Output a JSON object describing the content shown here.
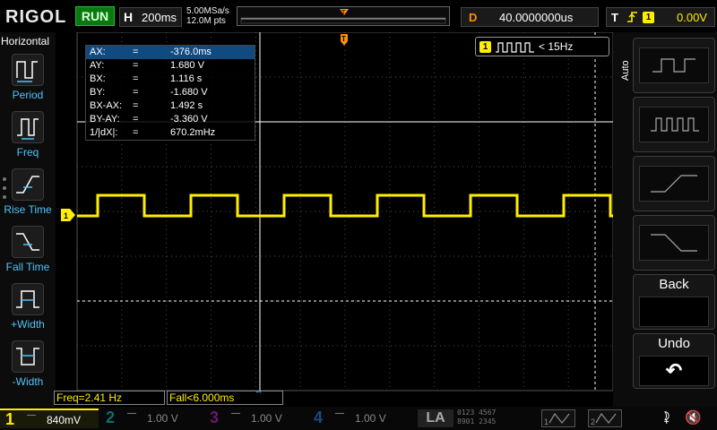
{
  "topbar": {
    "logo": "RIGOL",
    "run_status": "RUN",
    "horizontal_label": "H",
    "timebase": "200ms",
    "sample_rate": "5.00MSa/s",
    "memory_depth": "12.0M pts",
    "delay_label": "D",
    "delay_value": "40.0000000us",
    "trigger_label": "T",
    "trigger_edge": "ℱ",
    "trigger_source": "1",
    "trigger_level": "0.00V"
  },
  "left_menu": {
    "title": "Horizontal",
    "items": [
      {
        "label": "Period",
        "icon": "period-icon"
      },
      {
        "label": "Freq",
        "icon": "freq-icon"
      },
      {
        "label": "Rise Time",
        "icon": "rise-time-icon"
      },
      {
        "label": "Fall Time",
        "icon": "fall-time-icon"
      },
      {
        "label": "+Width",
        "icon": "pos-width-icon"
      },
      {
        "label": "-Width",
        "icon": "neg-width-icon"
      }
    ]
  },
  "cursor_readout": {
    "rows": [
      {
        "label": "AX:",
        "value": "-376.0ms"
      },
      {
        "label": "AY:",
        "value": "1.680 V"
      },
      {
        "label": "BX:",
        "value": "1.116 s"
      },
      {
        "label": "BY:",
        "value": "-1.680 V"
      },
      {
        "label": "BX-AX:",
        "value": "1.492 s"
      },
      {
        "label": "BY-AY:",
        "value": "-3.360 V"
      },
      {
        "label": "1/|dX|:",
        "value": "670.2mHz"
      }
    ],
    "equals": "="
  },
  "frequency_counter": {
    "channel": "1",
    "text": "< 15Hz"
  },
  "measurements": {
    "freq": "Freq=2.41 Hz",
    "fall": "Fall<6.000ms"
  },
  "right_menu": {
    "auto_label": "Auto",
    "back_label": "Back",
    "undo_label": "Undo"
  },
  "bottombar": {
    "channels": [
      {
        "num": "1",
        "coupling": "—",
        "scale": "840mV"
      },
      {
        "num": "2",
        "coupling": "—",
        "scale": "1.00 V"
      },
      {
        "num": "3",
        "coupling": "—",
        "scale": "1.00 V"
      },
      {
        "num": "4",
        "coupling": "—",
        "scale": "1.00 V"
      }
    ],
    "la_label": "LA",
    "la_digits_row1": "0123 4567",
    "la_digits_row2": "8901 2345",
    "math1": "1",
    "math2": "2"
  },
  "colors": {
    "ch1": "#ffee00",
    "accent_orange": "#ff9000",
    "label_blue": "#4fc3f7",
    "run_green": "#0a7a10"
  }
}
